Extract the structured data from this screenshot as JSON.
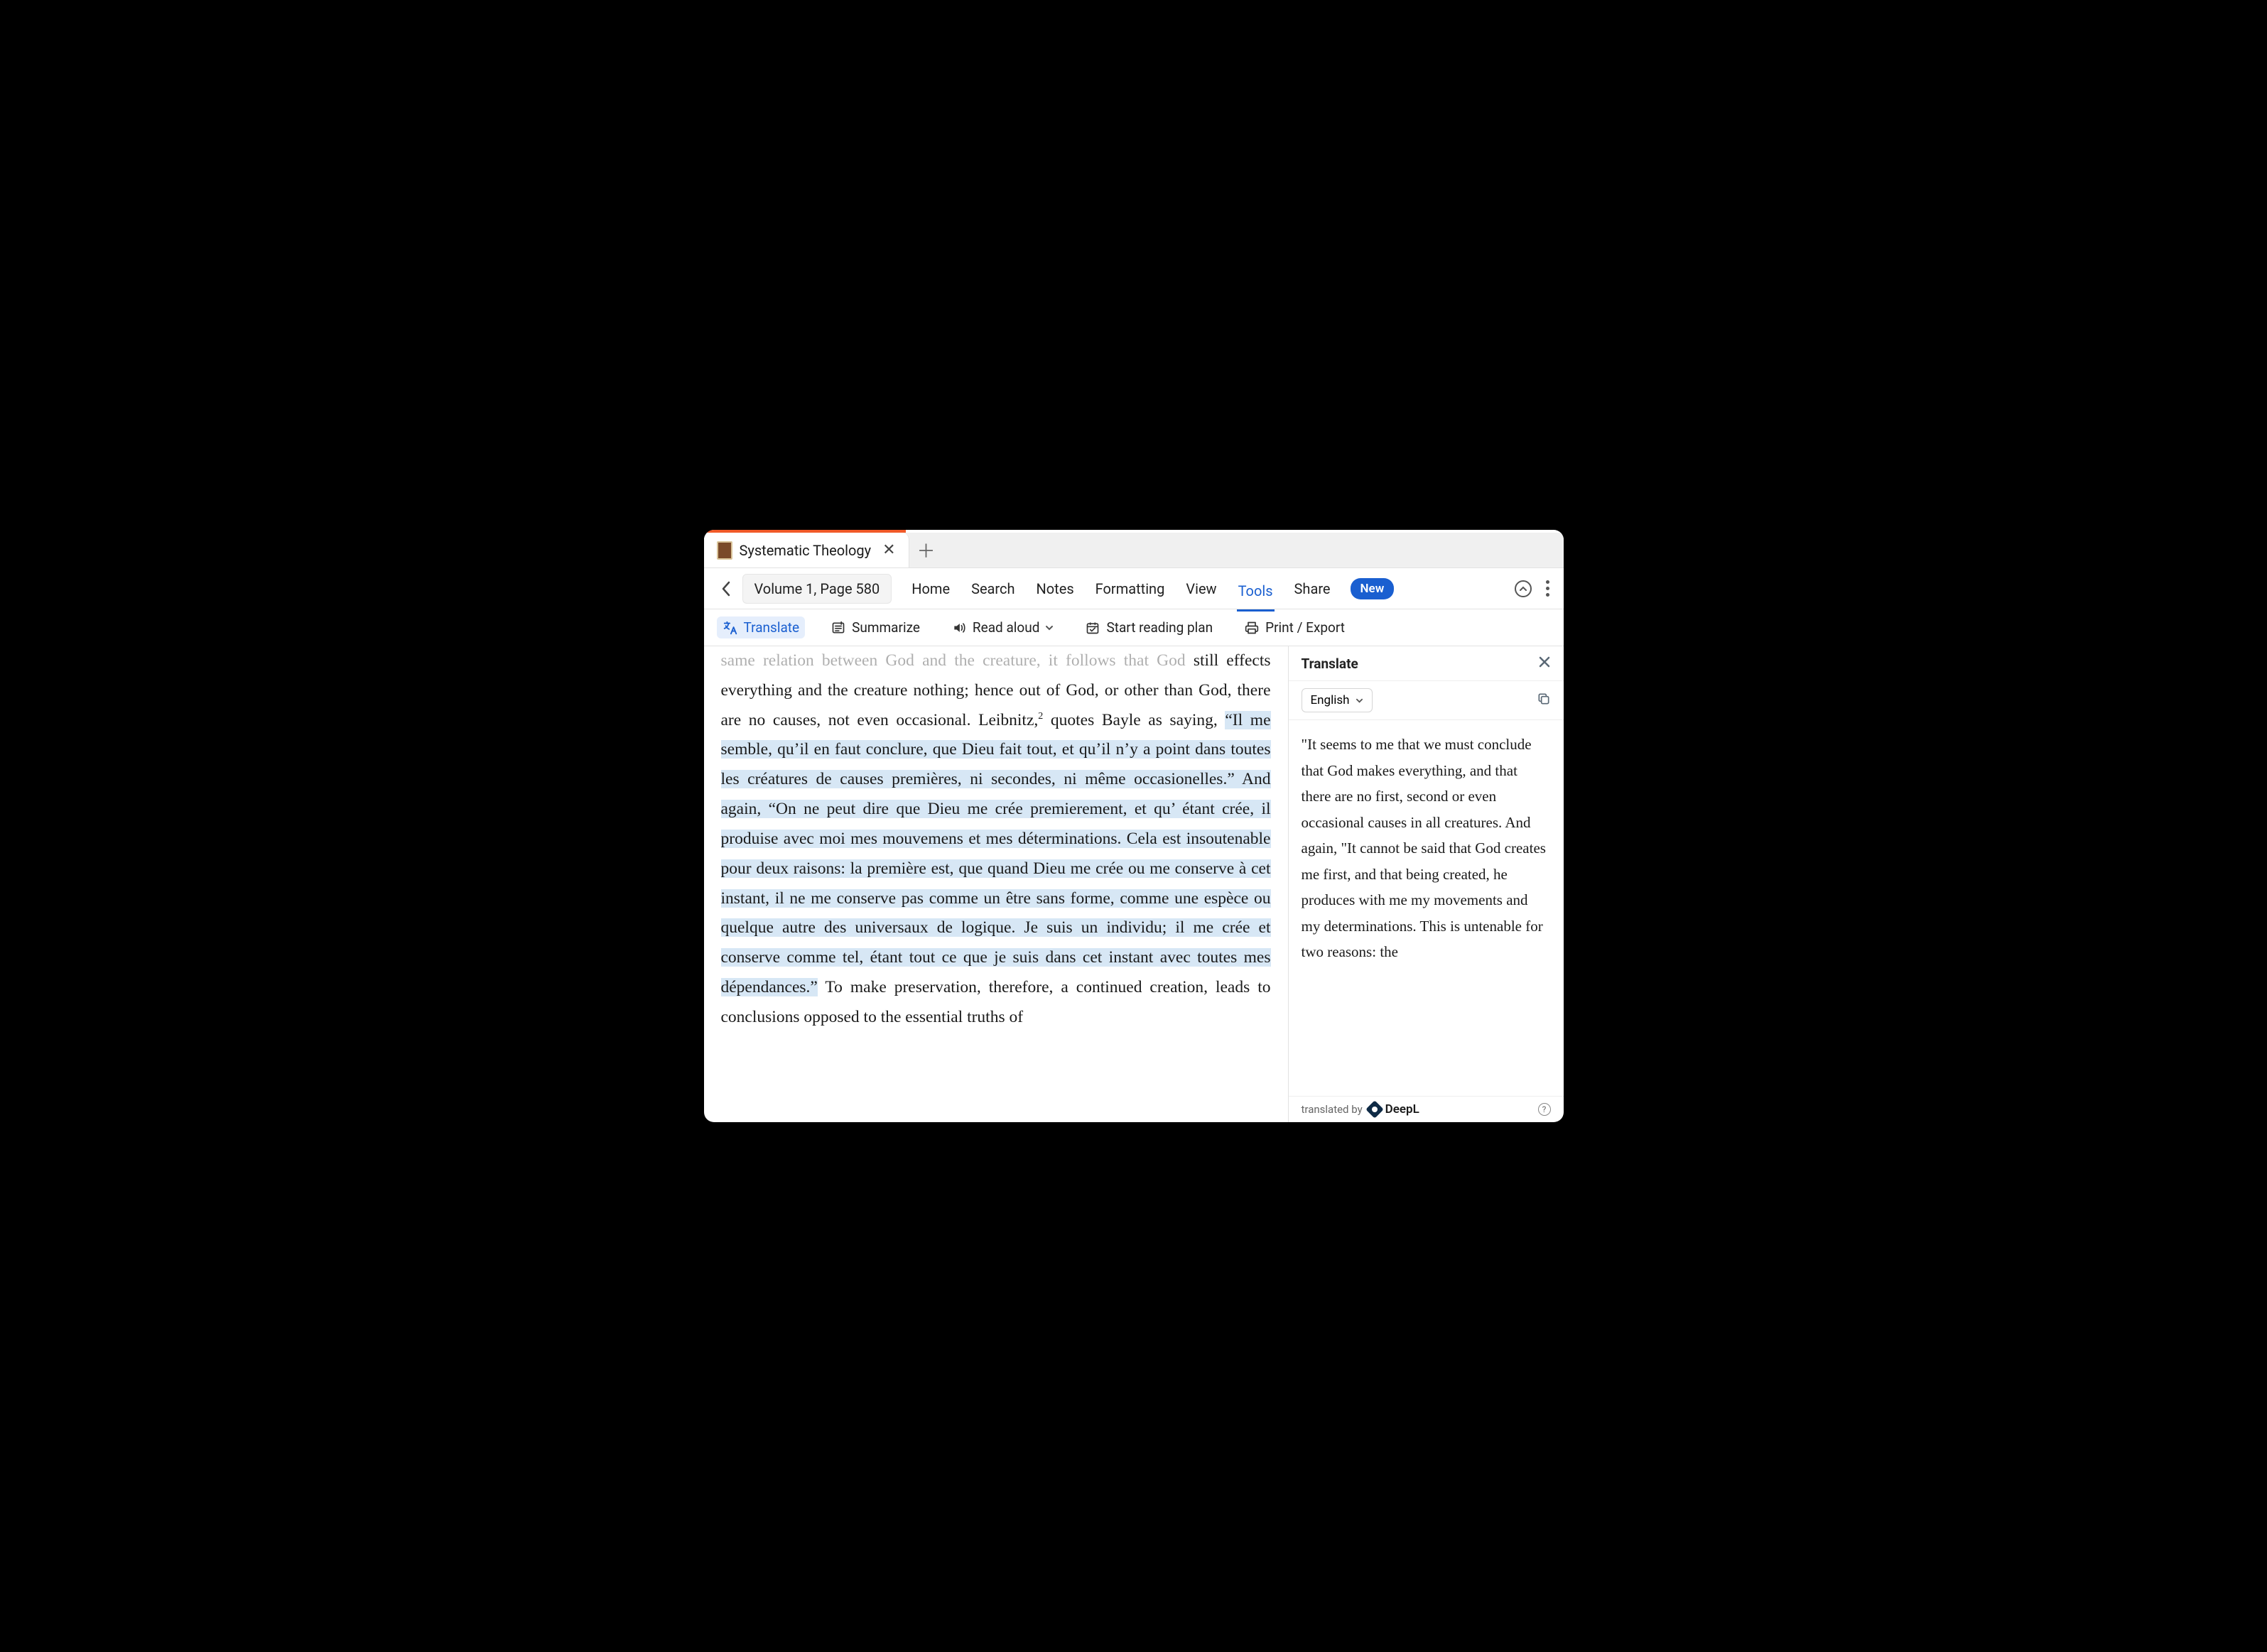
{
  "tab": {
    "title": "Systematic Theology"
  },
  "breadcrumb": "Volume 1, Page 580",
  "menu": {
    "home": "Home",
    "search": "Search",
    "notes": "Notes",
    "formatting": "Formatting",
    "view": "View",
    "tools": "Tools",
    "share": "Share",
    "new_badge": "New"
  },
  "toolbar": {
    "translate": "Translate",
    "summarize": "Summarize",
    "read_aloud": "Read aloud",
    "start_plan": "Start reading plan",
    "print_export": "Print / Export"
  },
  "reader": {
    "cutoff_top": "same relation between God and the creature, it follows that God",
    "pre_hl_1": "still effects everything and the creature nothing; hence out of God, or other than God, there are no causes, not even occasional. Leibnitz,",
    "sup": "2",
    "pre_hl_2": " quotes Bayle as saying, ",
    "hl": "“Il me semble, qu’il en faut conclure, que Dieu fait tout, et qu’il n’y a point dans toutes les créatures de causes premières, ni secondes, ni même occasionelles.” And again, “On ne peut dire que Dieu me crée premierement, et qu’ étant crée, il produise avec moi mes mouvemens et mes déterminations. Cela est insoutenable pour deux raisons: la première est, que quand Dieu me crée ou me conserve à cet instant, il ne me conserve pas comme un être sans forme, comme une espèce ou quelque autre des universaux de logique. Je suis un individu; il me crée et conserve comme tel, étant tout ce que je suis dans cet instant avec toutes mes dépendances.”",
    "post_hl": " To make preservation, therefore, a continued creation, leads to conclusions opposed to the essential truths of"
  },
  "panel": {
    "title": "Translate",
    "language": "English",
    "translation": "\"It seems to me that we must conclude that God makes everything, and that there are no first, second or even occasional causes in all creatures. And again, \"It cannot be said that God creates me first, and that being created, he produces with me my movements and my determinations. This is untenable for two reasons: the",
    "footer_pre": "translated by",
    "provider": "DeepL"
  }
}
